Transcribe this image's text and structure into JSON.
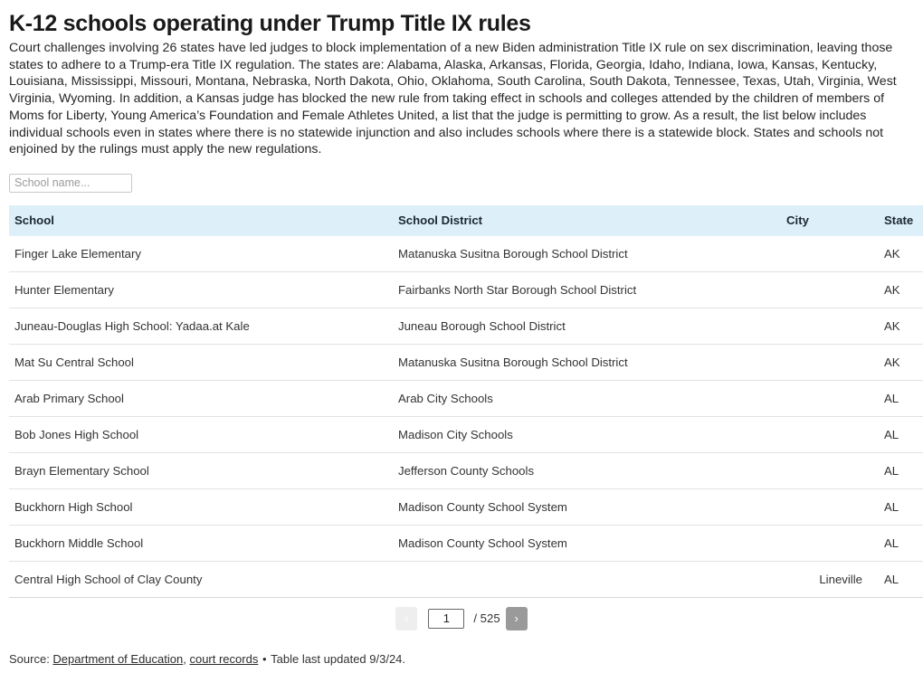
{
  "header": {
    "title": "K-12 schools operating under Trump Title IX rules",
    "intro": "Court challenges involving 26 states have led judges to block implementation of a new Biden administration Title IX rule on sex discrimination, leaving those states to adhere to a Trump-era Title IX regulation. The states are: Alabama, Alaska, Arkansas, Florida, Georgia, Idaho, Indiana, Iowa, Kansas, Kentucky, Louisiana, Mississippi, Missouri, Montana, Nebraska, North Dakota, Ohio, Oklahoma, South Carolina, South Dakota, Tennessee, Texas, Utah, Virginia, West Virginia, Wyoming. In addition, a Kansas judge has blocked the new rule from taking effect in schools and colleges attended by the children of members of Moms for Liberty, Young America’s Foundation and Female Athletes United, a list that the judge is permitting to grow. As a result, the list below includes individual schools even in states where there is no statewide injunction and also includes schools where there is a statewide block. States and schools not enjoined by the rulings must apply the new regulations."
  },
  "search": {
    "placeholder": "School name...",
    "value": ""
  },
  "table": {
    "columns": [
      "School",
      "School District",
      "City",
      "State"
    ],
    "rows": [
      {
        "school": "Finger Lake Elementary",
        "district": "Matanuska Susitna Borough School District",
        "city": "",
        "state": "AK"
      },
      {
        "school": "Hunter Elementary",
        "district": "Fairbanks North Star Borough School District",
        "city": "",
        "state": "AK"
      },
      {
        "school": "Juneau-Douglas High School: Yadaa.at Kale",
        "district": "Juneau Borough School District",
        "city": "",
        "state": "AK"
      },
      {
        "school": "Mat Su Central School",
        "district": "Matanuska Susitna Borough School District",
        "city": "",
        "state": "AK"
      },
      {
        "school": "Arab Primary School",
        "district": "Arab City Schools",
        "city": "",
        "state": "AL"
      },
      {
        "school": "Bob Jones High School",
        "district": "Madison City Schools",
        "city": "",
        "state": "AL"
      },
      {
        "school": "Brayn Elementary School",
        "district": "Jefferson County Schools",
        "city": "",
        "state": "AL"
      },
      {
        "school": "Buckhorn High School",
        "district": "Madison County School System",
        "city": "",
        "state": "AL"
      },
      {
        "school": "Buckhorn Middle School",
        "district": "Madison County School System",
        "city": "",
        "state": "AL"
      },
      {
        "school": "Central High School of Clay County",
        "district": "",
        "city": "Lineville",
        "state": "AL"
      }
    ]
  },
  "pagination": {
    "prev_label": "‹",
    "next_label": "›",
    "current_page": "1",
    "total_label": "/ 525"
  },
  "footer": {
    "source_prefix": "Source: ",
    "link1": "Department of Education",
    "comma": ", ",
    "link2": "court records",
    "separator": " • ",
    "updated": "Table last updated 9/3/24."
  },
  "colors": {
    "header_bg": "#ddeff8",
    "next_button": "#9a9a9a",
    "prev_button": "#eeeeee",
    "row_border": "#e2e2e2"
  }
}
